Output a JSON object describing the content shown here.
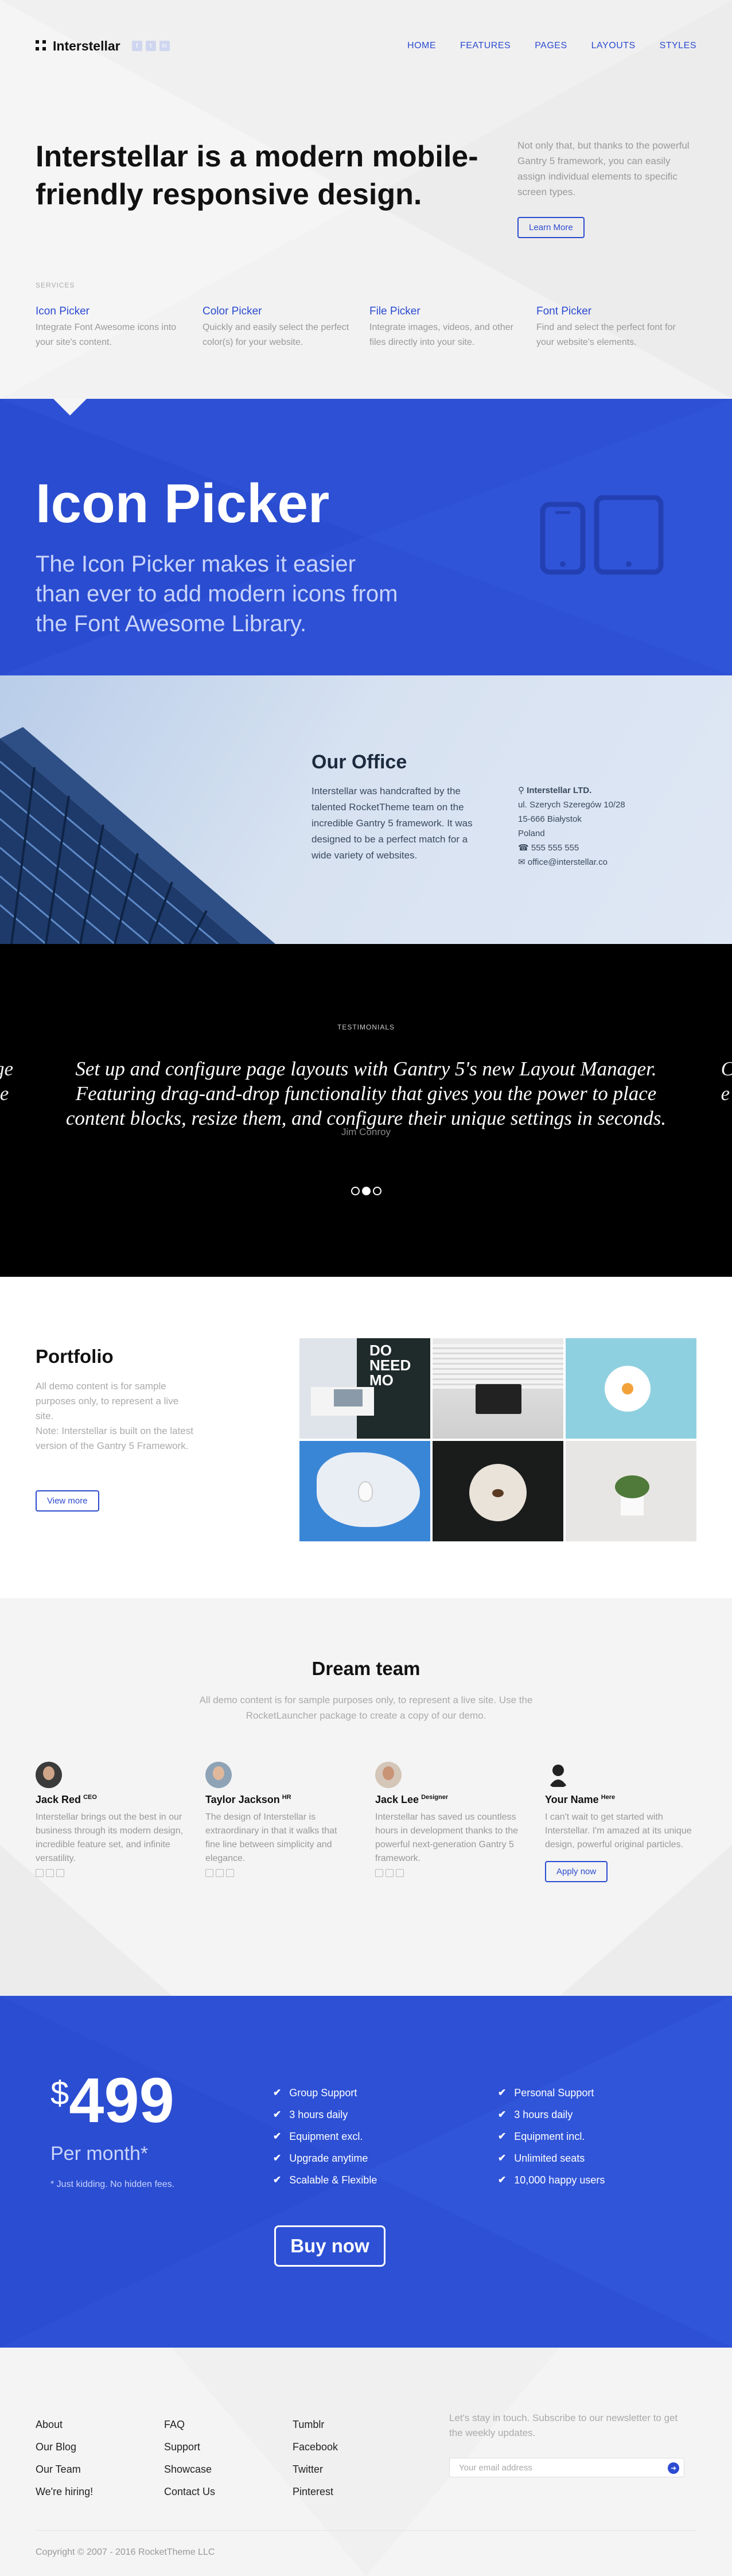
{
  "nav": {
    "brand": "Interstellar",
    "social_icons": [
      "facebook-icon",
      "twitter-icon",
      "linkedin-icon"
    ],
    "menu": [
      "HOME",
      "FEATURES",
      "PAGES",
      "LAYOUTS",
      "STYLES"
    ]
  },
  "hero": {
    "title": "Interstellar is a modern mobile-friendly responsive design.",
    "intro": "Not only that, but thanks to the powerful Gantry 5 framework, you can easily assign individual elements to specific screen types.",
    "button": "Learn More",
    "services_label": "SERVICES",
    "features": [
      {
        "title": "Icon Picker",
        "text": "Integrate Font Awesome icons into your site's content."
      },
      {
        "title": "Color Picker",
        "text": "Quickly and easily select the perfect color(s) for your website."
      },
      {
        "title": "File Picker",
        "text": "Integrate images, videos, and other files directly into your site."
      },
      {
        "title": "Font Picker",
        "text": "Find and select the perfect font for your website's elements."
      }
    ]
  },
  "icon_picker": {
    "title": "Icon Picker",
    "text": "The Icon Picker makes it easier than ever to add modern icons from the Font Awesome Library."
  },
  "office": {
    "title": "Our Office",
    "text": "Interstellar was handcrafted by the talented RocketTheme team on the incredible Gantry 5 framework. It was designed to be a perfect match for a wide variety of websites.",
    "company": "Interstellar LTD.",
    "street": "ul. Szerych Szeregów 10/28",
    "city": "15-666 Białystok",
    "country": "Poland",
    "phone": "555 555 555",
    "email": "office@interstellar.co"
  },
  "testimonials": {
    "label": "TESTIMONIALS",
    "quote": "Set up and configure page layouts with Gantry 5's new Layout Manager. Featuring drag-and-drop functionality that gives you the power to place content blocks, resize them, and configure their unique settings in seconds.",
    "author": "Jim Conroy",
    "edge_left": "ge\nle",
    "edge_right": "C\ne",
    "active_slide": 2,
    "slides": 3
  },
  "portfolio": {
    "title": "Portfolio",
    "text": "All demo content is for sample purposes only, to represent a live site.",
    "note": "Note: Interstellar is built on the latest version of the Gantry 5 Framework.",
    "button": "View more",
    "tile_text": "DO NEED MO"
  },
  "team": {
    "title": "Dream team",
    "subtitle": "All demo content is for sample purposes only, to represent a live site. Use the RocketLauncher package to create a copy of our demo.",
    "members": [
      {
        "name": "Jack Red",
        "role": "CEO",
        "text": "Interstellar brings out the best in our business through its modern design, incredible feature set, and infinite versatility."
      },
      {
        "name": "Taylor Jackson",
        "role": "HR",
        "text": "The design of Interstellar is extraordinary in that it walks that fine line between simplicity and elegance."
      },
      {
        "name": "Jack Lee",
        "role": "Designer",
        "text": "Interstellar has saved us countless hours in development thanks to the powerful next-generation Gantry 5 framework."
      },
      {
        "name": "Your Name",
        "role": "Here",
        "text": "I can't wait to get started with Interstellar. I'm amazed at its unique design, powerful original particles."
      }
    ],
    "apply_label": "Apply now"
  },
  "pricing": {
    "currency": "$",
    "amount": "499",
    "period": "Per month*",
    "note": "* Just kidding. No hidden fees.",
    "features_left": [
      "Group Support",
      "3 hours daily",
      "Equipment excl.",
      "Upgrade anytime",
      "Scalable & Flexible"
    ],
    "features_right": [
      "Personal Support",
      "3 hours daily",
      "Equipment incl.",
      "Unlimited seats",
      "10,000 happy users"
    ],
    "button": "Buy now"
  },
  "footer": {
    "col1": [
      "About",
      "Our Blog",
      "Our Team",
      "We're hiring!"
    ],
    "col2": [
      "FAQ",
      "Support",
      "Showcase",
      "Contact Us"
    ],
    "col3": [
      "Tumblr",
      "Facebook",
      "Twitter",
      "Pinterest"
    ],
    "newsletter": "Let's stay in touch. Subscribe to our newsletter to get the weekly updates.",
    "email_placeholder": "Your email address",
    "copyright": "Copyright © 2007 - 2016 RocketTheme LLC"
  },
  "colors": {
    "accent": "#2d50d4",
    "link": "#2b4bd0"
  }
}
